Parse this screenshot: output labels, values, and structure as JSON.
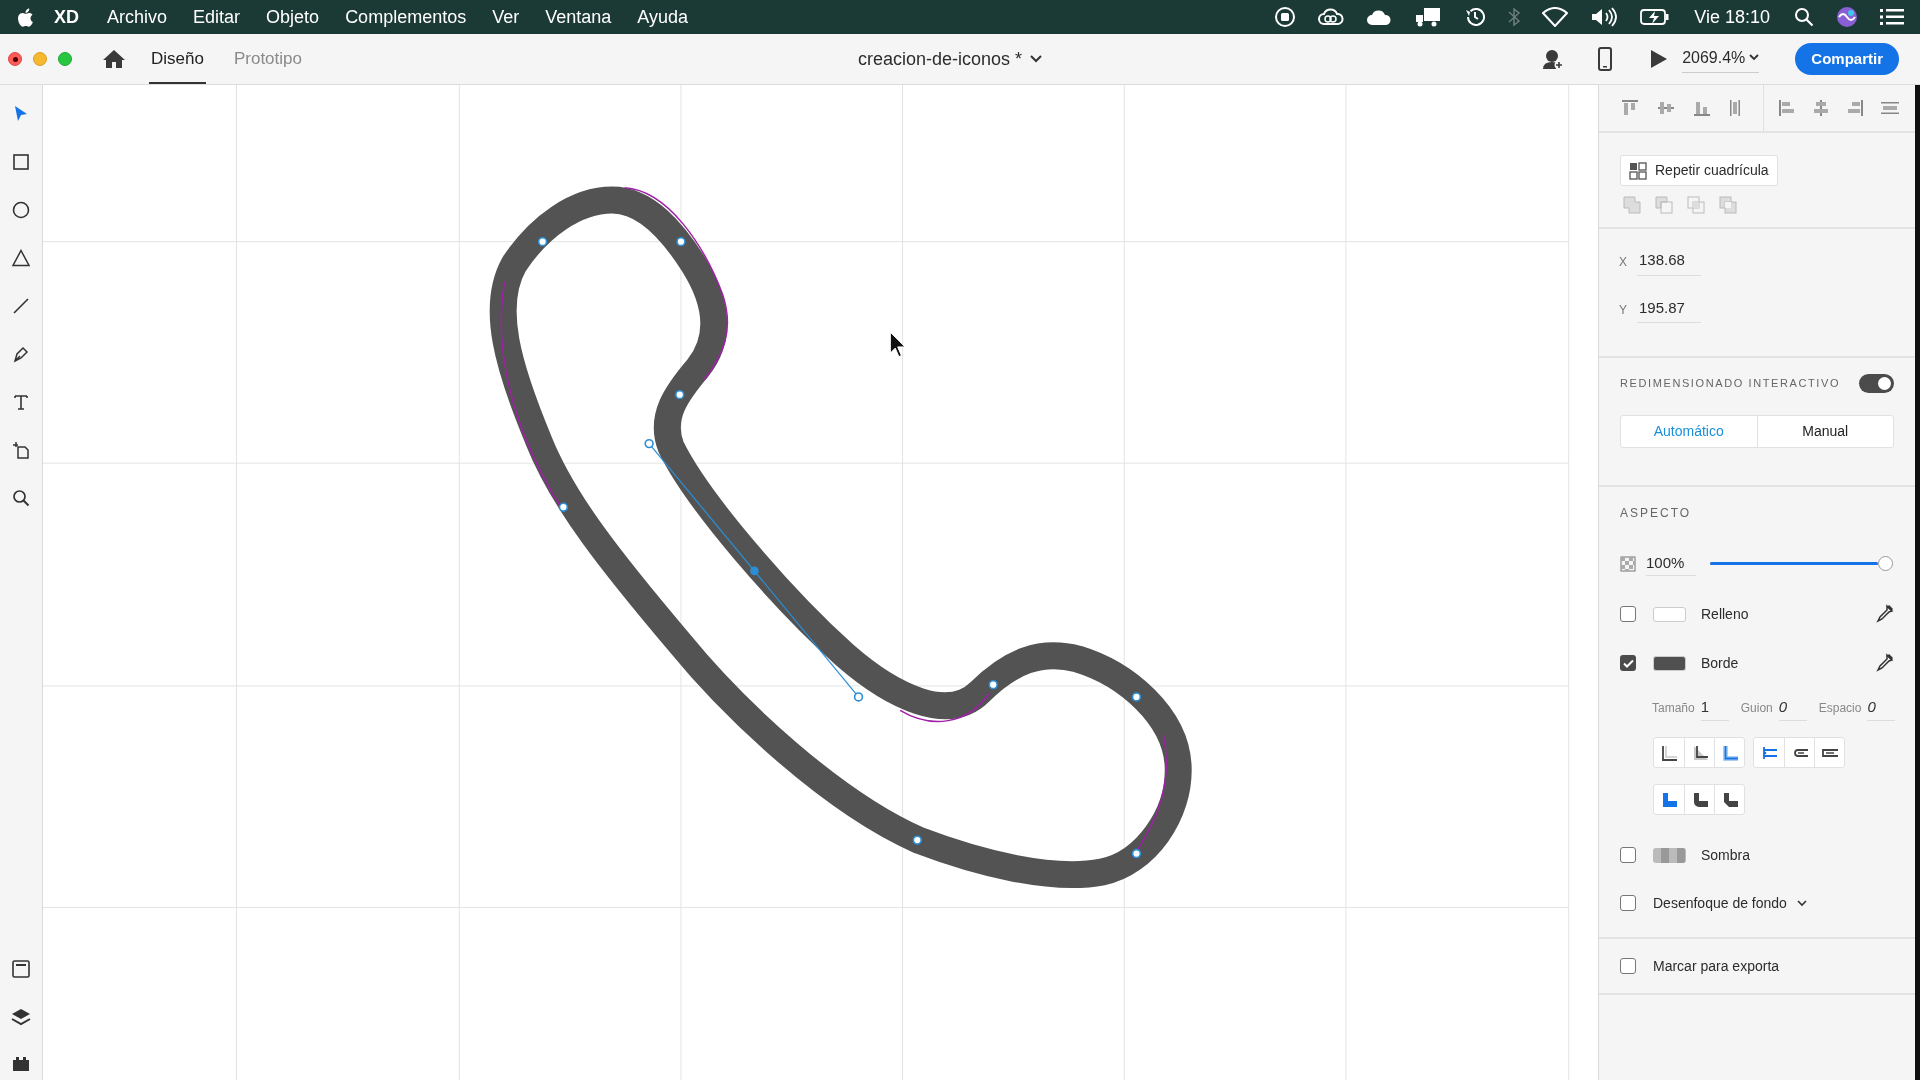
{
  "menu_bar": {
    "app": "XD",
    "items": [
      "Archivo",
      "Editar",
      "Objeto",
      "Complementos",
      "Ver",
      "Ventana",
      "Ayuda"
    ],
    "clock": "Vie 18:10"
  },
  "title_bar": {
    "tabs": [
      {
        "label": "Diseño",
        "selected": true
      },
      {
        "label": "Prototipo",
        "selected": false
      }
    ],
    "document": "creacion-de-iconos *",
    "zoom": "2069.4%",
    "share": "Compartir"
  },
  "tools": [
    {
      "kind": "select",
      "selected": true
    },
    {
      "kind": "rectangle",
      "selected": false
    },
    {
      "kind": "ellipse",
      "selected": false
    },
    {
      "kind": "polygon",
      "selected": false
    },
    {
      "kind": "line",
      "selected": false
    },
    {
      "kind": "pen",
      "selected": false
    },
    {
      "kind": "text",
      "selected": false
    },
    {
      "kind": "artboard",
      "selected": false
    },
    {
      "kind": "zoom",
      "selected": false
    }
  ],
  "panel": {
    "repeat_grid": "Repetir cuadrícula",
    "x": {
      "label": "X",
      "value": "138.68"
    },
    "y": {
      "label": "Y",
      "value": "195.87"
    },
    "responsive": {
      "title": "REDIMENSIONADO INTERACTIVO",
      "on": true,
      "options": [
        {
          "label": "Automático",
          "selected": true
        },
        {
          "label": "Manual",
          "selected": false
        }
      ]
    },
    "appearance": {
      "title": "ASPECTO",
      "opacity": "100%",
      "level": 1.0,
      "rows": [
        {
          "label": "Relleno",
          "checked": false,
          "color": "#ffffff"
        },
        {
          "label": "Borde",
          "checked": true,
          "color": "#505050"
        }
      ],
      "stroke_fields": [
        {
          "label": "Tamaño",
          "value": "1"
        },
        {
          "label": "Guion",
          "value": "0"
        },
        {
          "label": "Espacio",
          "value": "0"
        }
      ],
      "stroke_position": [
        {
          "kind": "inner",
          "selected": false
        },
        {
          "kind": "outer",
          "selected": false
        },
        {
          "kind": "center",
          "selected": true
        }
      ],
      "caps": [
        {
          "kind": "butt",
          "selected": true
        },
        {
          "kind": "round",
          "selected": false
        },
        {
          "kind": "square",
          "selected": false
        }
      ],
      "joins": [
        {
          "kind": "miter",
          "selected": true
        },
        {
          "kind": "round",
          "selected": false
        },
        {
          "kind": "bevel",
          "selected": false
        }
      ],
      "shadow": {
        "label": "Sombra",
        "checked": false
      },
      "blur": {
        "label": "Desenfoque de fondo",
        "checked": false
      }
    },
    "export": {
      "label": "Marcar para exporta",
      "checked": false
    }
  }
}
